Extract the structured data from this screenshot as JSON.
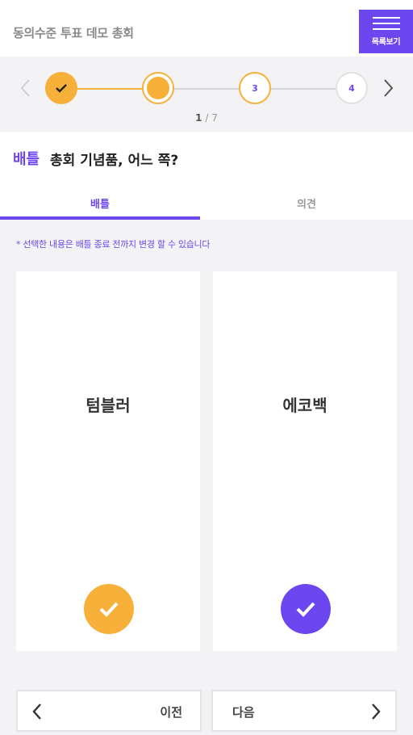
{
  "header": {
    "title": "동의수준 투표 데모 총회",
    "menu_label": "목록보기",
    "menu_icon": "hamburger-icon"
  },
  "stepper": {
    "steps": [
      {
        "label": "",
        "state": "done"
      },
      {
        "label": "",
        "state": "current"
      },
      {
        "label": "3",
        "state": "upcoming"
      },
      {
        "label": "4",
        "state": "upcoming"
      }
    ],
    "current_page": "1",
    "total_pages": "/ 7"
  },
  "question": {
    "tag": "배틀",
    "text": "총회 기념품, 어느 쪽?"
  },
  "tabs": [
    {
      "label": "배틀",
      "active": true
    },
    {
      "label": "의견",
      "active": false
    }
  ],
  "notice": "* 선택한 내용은 배틀 종료 전까지 변경 할 수 있습니다",
  "options": [
    {
      "label": "텀블러",
      "color": "#f7b03a"
    },
    {
      "label": "에코백",
      "color": "#6c47ef"
    }
  ],
  "navigation": {
    "prev_label": "이전",
    "next_label": "다음"
  },
  "colors": {
    "accent": "#6c47ef",
    "highlight": "#f7b03a"
  }
}
